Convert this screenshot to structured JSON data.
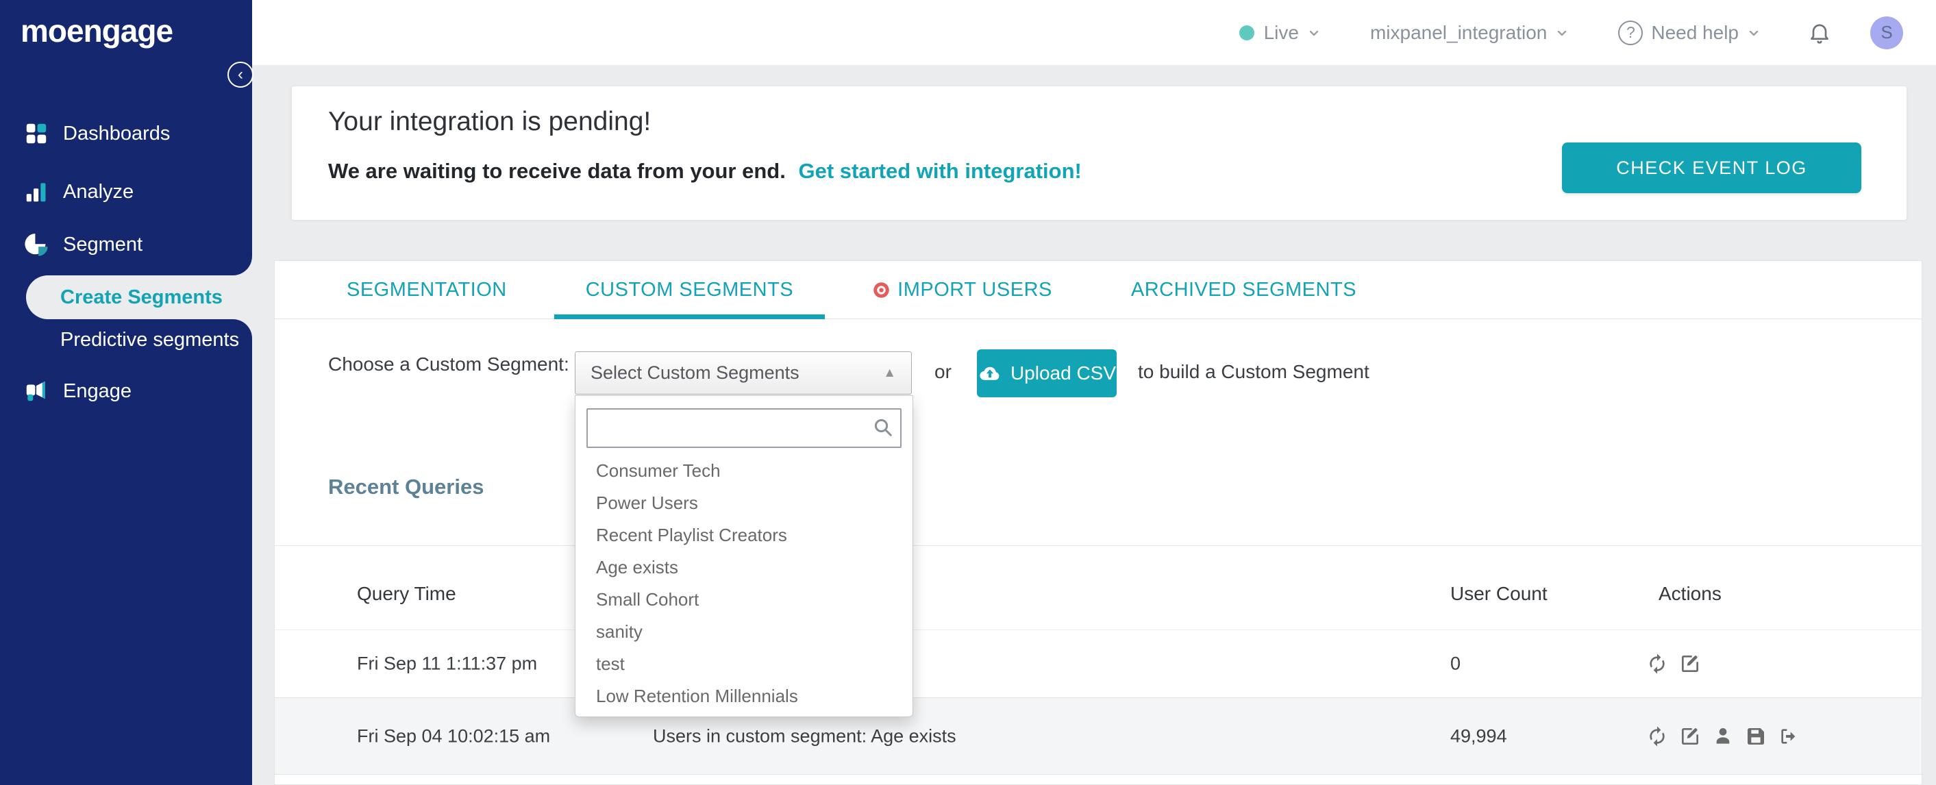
{
  "topbar": {
    "live_label": "Live",
    "project_name": "mixpanel_integration",
    "help_label": "Need help",
    "avatar_initial": "S"
  },
  "sidebar": {
    "logo_text": "moengage",
    "items": {
      "dashboards": "Dashboards",
      "analyze": "Analyze",
      "segment": "Segment",
      "create_segments": "Create Segments",
      "predictive_segments": "Predictive segments",
      "engage": "Engage"
    }
  },
  "banner": {
    "title": "Your integration is pending!",
    "subtitle": "We are waiting to receive data from your end.",
    "link_label": "Get started with integration!",
    "button_label": "CHECK EVENT LOG"
  },
  "tabs": {
    "segmentation": "SEGMENTATION",
    "custom_segments": "CUSTOM SEGMENTS",
    "import_users": "IMPORT USERS",
    "archived_segments": "ARCHIVED SEGMENTS"
  },
  "picker": {
    "label": "Choose a Custom Segment:",
    "select_value": "Select Custom Segments",
    "or_text": "or",
    "upload_label": "Upload CSV",
    "tail_text": "to build a Custom Segment",
    "search_value": "",
    "options": [
      "Consumer Tech",
      "Power Users",
      "Recent Playlist Creators",
      "Age exists",
      "Small Cohort",
      "sanity",
      "test",
      "Low Retention Millennials"
    ]
  },
  "recent_queries": {
    "heading": "Recent Queries",
    "columns": {
      "time": "Query Time",
      "count": "User Count",
      "actions": "Actions"
    },
    "rows": [
      {
        "time": "Fri Sep 11 1:11:37 pm",
        "query": "",
        "count": "0"
      },
      {
        "time": "Fri Sep 04 10:02:15 am",
        "query": "Users in custom segment: Age exists",
        "count": "49,994"
      }
    ]
  },
  "colors": {
    "accent_teal": "#12a3b4",
    "sidebar_navy": "#15276e",
    "live_dot": "#5fc9c0",
    "avatar_bg": "#a7a9f1",
    "heading_slate": "#5d8196",
    "import_dot": "#e25c5c"
  }
}
